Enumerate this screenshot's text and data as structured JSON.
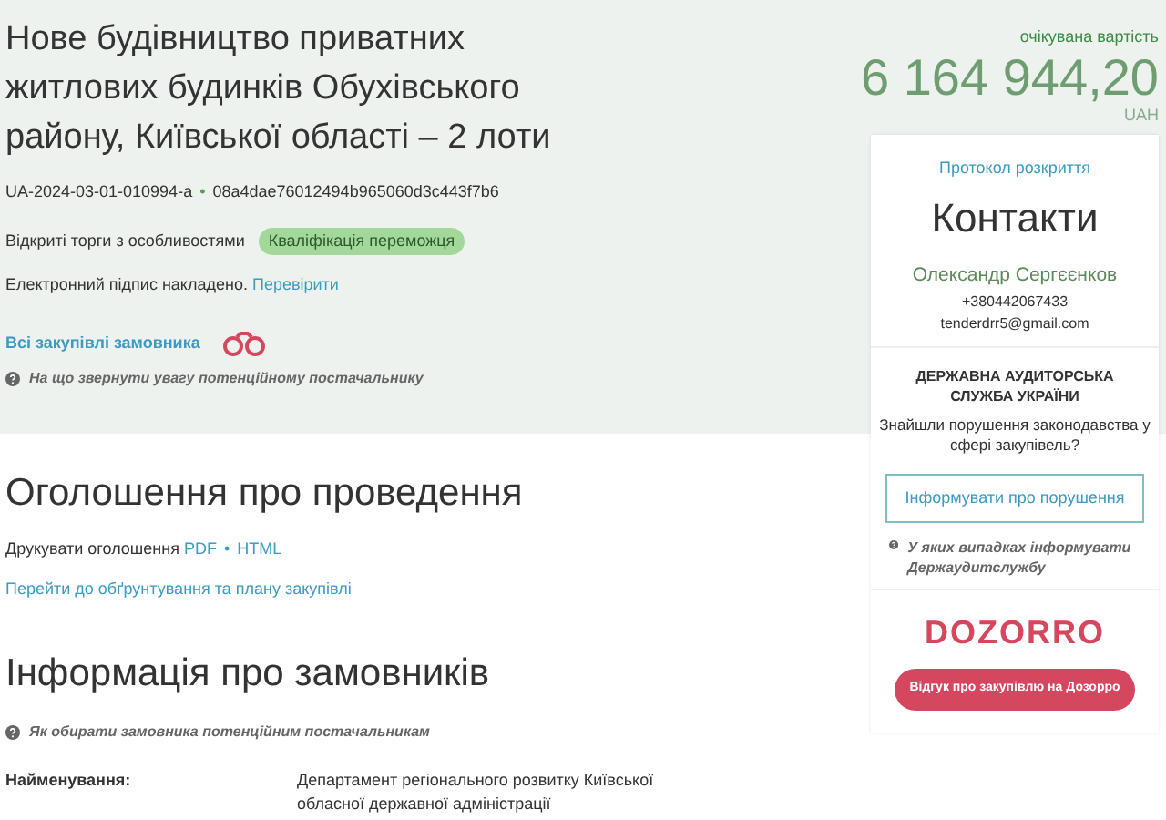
{
  "tender": {
    "title": "Нове будівництво приватних житлових будинків Обухівського району, Київської області – 2 лоти",
    "tender_id": "UA-2024-03-01-010994-a",
    "id_separator": "•",
    "hash": "08a4dae76012494b965060d3c443f7b6",
    "procedure": "Відкриті торги з особливостями",
    "status_badge": "Кваліфікація переможця",
    "signature_text": "Електронний підпис накладено.",
    "signature_link": "Перевірити",
    "all_purchases_link": "Всі закупівлі замовника",
    "hint": "На що звернути увагу потенційному постачальнику"
  },
  "announcement": {
    "heading": "Оголошення про проведення",
    "print_label": "Друкувати оголошення",
    "print_links": [
      "PDF",
      "HTML"
    ],
    "link_separator": "•",
    "plan_link": "Перейти до обґрунтування та плану закупівлі"
  },
  "customer": {
    "heading": "Інформація про замовників",
    "hint": "Як обирати замовника потенційним постачальникам",
    "fields": [
      {
        "label": "Найменування:",
        "value": "Департамент регіонального розвитку Київської обласної державної адміністрації"
      }
    ]
  },
  "sidebar": {
    "expected_label": "очікувана вартість",
    "amount": "6 164 944,20",
    "currency": "UAH",
    "protocol_link": "Протокол розкриття",
    "contacts_title": "Контакти",
    "contact_name": "Олександр Сергєєнков",
    "phone": "+380442067433",
    "email": "tenderdrr5@gmail.com",
    "audit": {
      "title": "ДЕРЖАВНА АУДИТОРСЬКА СЛУЖБА УКРАЇНИ",
      "question": "Знайшли порушення законодавства у сфері закупівель?",
      "button": "Інформувати про порушення",
      "hint": "У яких випадках інформувати Держаудитслужбу"
    },
    "dozorro": {
      "logo": "DOZORRO",
      "button": "Відгук про закупівлю на Дозорро"
    }
  }
}
